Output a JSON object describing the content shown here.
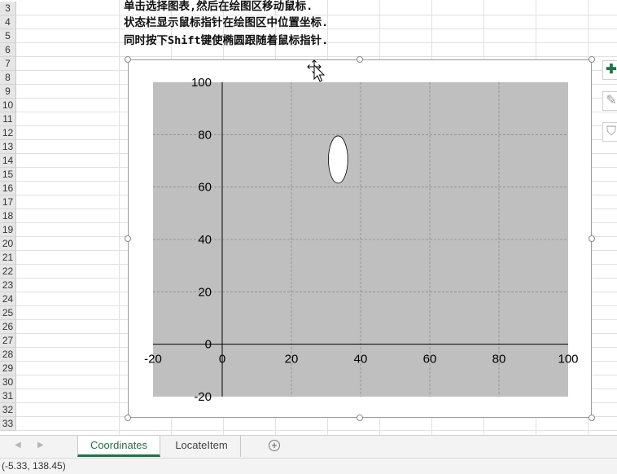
{
  "spreadsheet": {
    "visible_row_numbers": [
      "3",
      "4",
      "5",
      "6",
      "7",
      "8",
      "9",
      "10",
      "11",
      "12",
      "13",
      "14",
      "15",
      "16",
      "17",
      "18",
      "19",
      "20",
      "21",
      "22",
      "23",
      "24",
      "25",
      "26",
      "27",
      "28",
      "29",
      "30",
      "31",
      "32",
      "33"
    ]
  },
  "notes": [
    "单击选择图表,然后在绘图区移动鼠标.",
    "状态栏显示鼠标指针在绘图区中位置坐标.",
    "同时按下Shift键使椭圆跟随着鼠标指针."
  ],
  "chart_side_buttons": [
    {
      "icon": "plus-icon",
      "glyph": "✚",
      "color": "#217346"
    },
    {
      "icon": "brush-icon",
      "glyph": "✎",
      "color": "#bbbbbb"
    },
    {
      "icon": "filter-icon",
      "glyph": "⛉",
      "color": "#bbbbbb"
    }
  ],
  "chart_data": {
    "type": "scatter",
    "xlim": [
      -20,
      100
    ],
    "ylim": [
      -20,
      100
    ],
    "x_ticks": [
      "-20",
      "0",
      "20",
      "40",
      "60",
      "80",
      "100"
    ],
    "y_ticks": [
      "-20",
      "0",
      "20",
      "40",
      "60",
      "80",
      "100"
    ],
    "grid": true,
    "plot_background": "#bfbfbf",
    "ellipse": {
      "cx": 33.5,
      "cy": 70.5,
      "rx": 2.8,
      "ry": 9,
      "fill": "#ffffff"
    }
  },
  "sheet_tabs": [
    {
      "label": "Coordinates",
      "active": true
    },
    {
      "label": "LocateItem",
      "active": false
    }
  ],
  "status_bar": {
    "coordinates": "(-5.33, 138.45)"
  },
  "colors": {
    "accent": "#217346"
  }
}
